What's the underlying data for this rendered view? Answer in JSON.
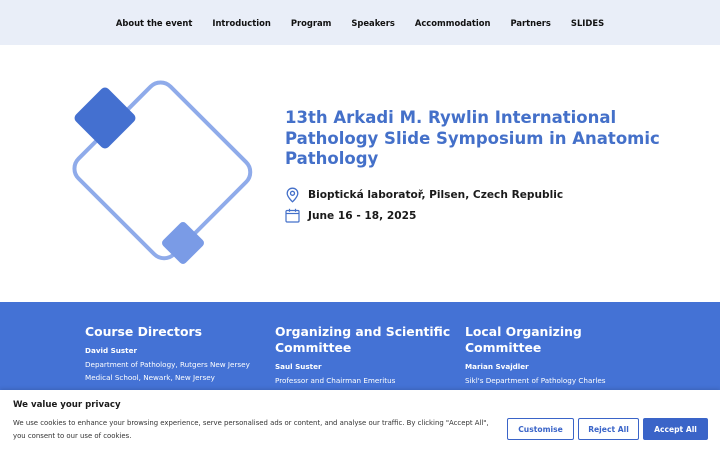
{
  "nav": {
    "items": [
      "About the event",
      "Introduction",
      "Program",
      "Speakers",
      "Accommodation",
      "Partners",
      "SLIDES"
    ]
  },
  "hero": {
    "title": "13th Arkadi M. Rywlin International Pathology Slide Symposium in Anatomic Pathology",
    "location": "Bioptická laboratoř, Pilsen, Czech Republic",
    "date": "June 16 - 18, 2025",
    "location_icon": "map-pin-icon",
    "date_icon": "calendar-icon"
  },
  "columns": [
    {
      "heading": "Course Directors",
      "name": "David Suster",
      "desc": "Department of Pathology, Rutgers New Jersey Medical School, Newark, New Jersey"
    },
    {
      "heading": "Organizing and Scientific Committee",
      "name": "Saul Suster",
      "desc": "Professor and Chairman Emeritus"
    },
    {
      "heading": "Local Organizing Committee",
      "name": "Marian Svajdler",
      "desc": "Sikl's Department of Pathology Charles"
    }
  ],
  "cookie": {
    "title": "We value your privacy",
    "text": "We use cookies to enhance your browsing experience, serve personalised ads or content, and analyse our traffic. By clicking \"Accept All\", you consent to our use of cookies.",
    "customise_label": "Customise",
    "reject_label": "Reject All",
    "accept_label": "Accept All"
  },
  "colors": {
    "accent": "#4470c9",
    "section_bg": "#4472d5",
    "nav_bg": "#e9eef8"
  }
}
